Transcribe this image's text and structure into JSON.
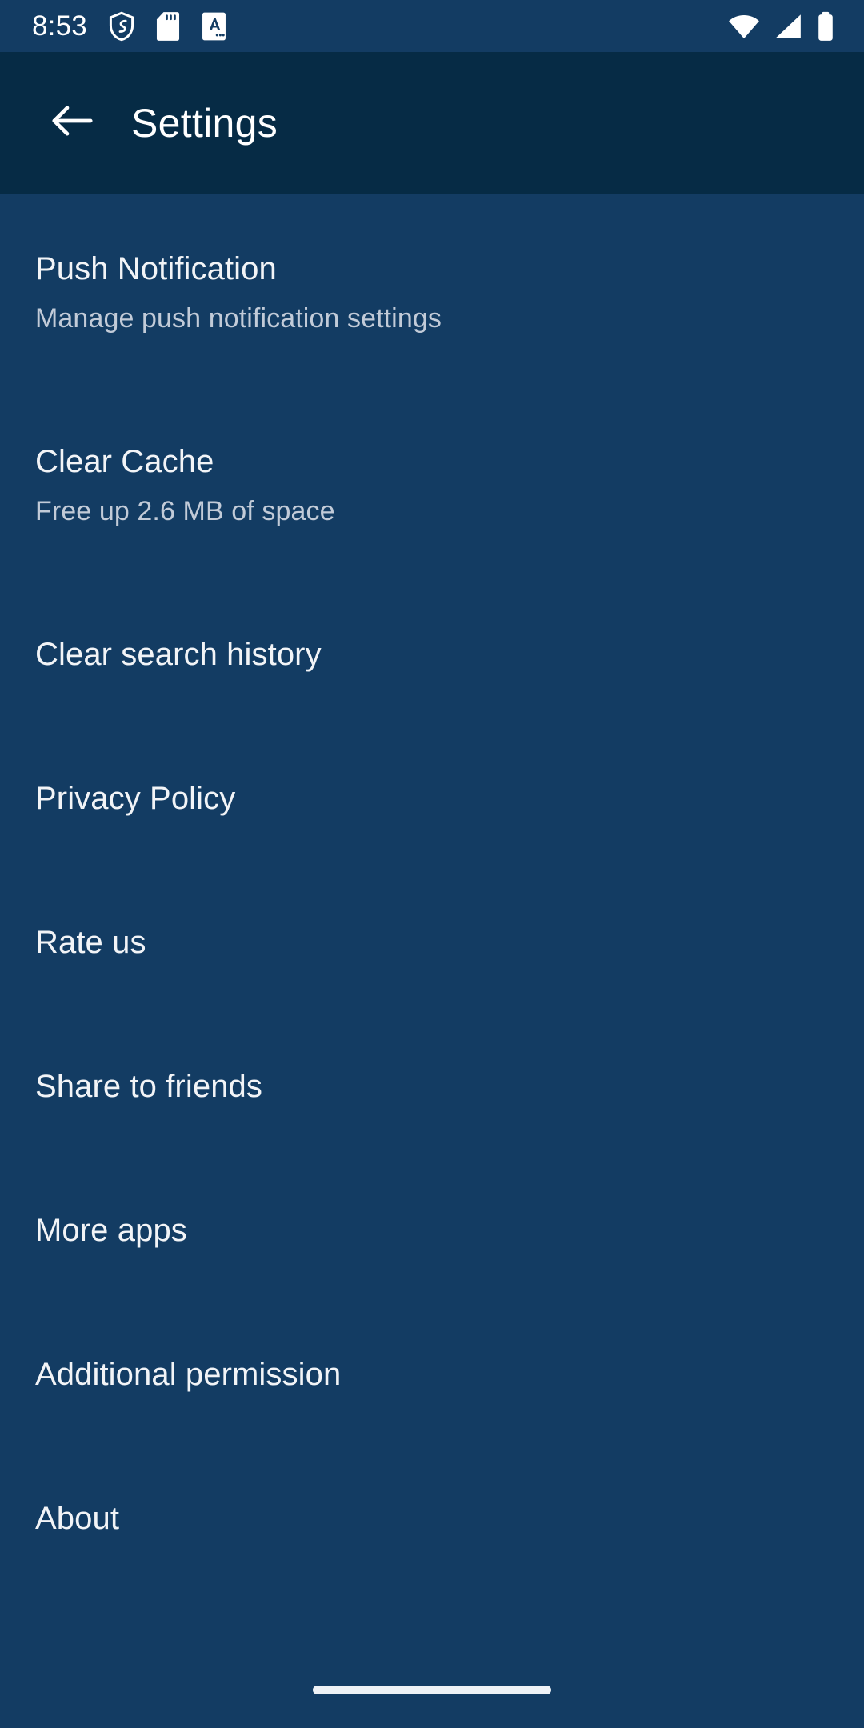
{
  "status_bar": {
    "time": "8:53",
    "left_icons": [
      {
        "name": "shield-icon",
        "label": "shield"
      },
      {
        "name": "sd-card-icon",
        "label": "sd card"
      },
      {
        "name": "translate-a-icon",
        "label": "translate"
      }
    ],
    "right_icons": [
      {
        "name": "wifi-icon",
        "label": "wifi"
      },
      {
        "name": "cellular-signal-icon",
        "label": "signal"
      },
      {
        "name": "battery-icon",
        "label": "battery"
      }
    ]
  },
  "app_bar": {
    "back_icon": "arrow-left-icon",
    "title": "Settings"
  },
  "colors": {
    "status_bar_bg": "#133c63",
    "app_bar_bg": "#062b45",
    "content_bg": "#133c63",
    "title_text": "#f2f4f7",
    "subtitle_text": "#c2cbd8",
    "icon_fill": "#ffffff",
    "gesture_pill": "#eef2f6"
  },
  "settings": {
    "items": [
      {
        "title": "Push Notification",
        "subtitle": "Manage push notification settings"
      },
      {
        "title": "Clear Cache",
        "subtitle": "Free up 2.6 MB of space"
      },
      {
        "title": "Clear search history"
      },
      {
        "title": "Privacy Policy"
      },
      {
        "title": "Rate us"
      },
      {
        "title": "Share to friends"
      },
      {
        "title": "More apps"
      },
      {
        "title": "Additional permission"
      },
      {
        "title": "About"
      }
    ]
  }
}
